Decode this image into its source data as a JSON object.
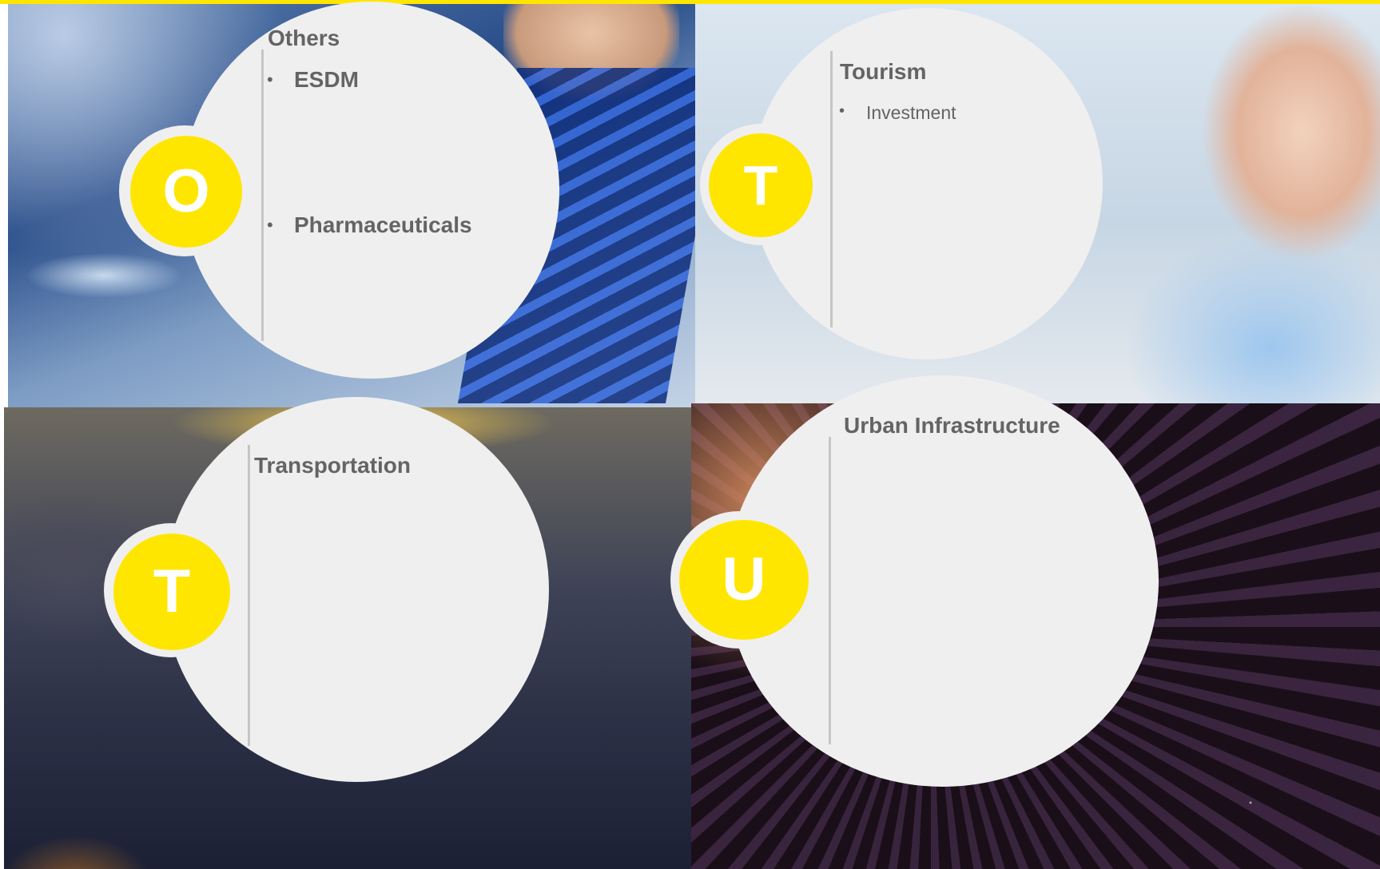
{
  "panels": {
    "others": {
      "letter": "O",
      "title": "Others",
      "items": [
        "ESDM",
        "Pharmaceuticals"
      ]
    },
    "tourism": {
      "letter": "T",
      "title": "Tourism",
      "items": [
        "Investment"
      ]
    },
    "transportation": {
      "letter": "T",
      "title": "Transportation"
    },
    "urban": {
      "letter": "U",
      "title": "Urban Infrastructure"
    }
  },
  "bullet_symbol": "•",
  "colors": {
    "accent": "#ffe600",
    "bubble": "#efefef",
    "text": "#646464",
    "divider": "#c6c6c6"
  }
}
